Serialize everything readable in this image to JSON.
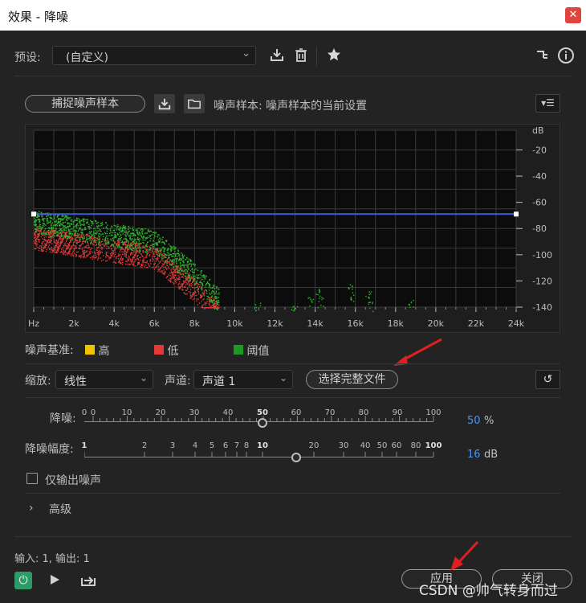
{
  "window": {
    "title": "效果 - 降噪",
    "close_glyph": "✕"
  },
  "preset": {
    "label": "预设:",
    "value": "(自定义)"
  },
  "capture": {
    "button_label": "捕捉噪声样本",
    "noise_text": "噪声样本: 噪声样本的当前设置"
  },
  "graph": {
    "db_unit": "dB",
    "y_ticks": [
      "-20",
      "-40",
      "-60",
      "-80",
      "-100",
      "-120",
      "-140"
    ],
    "x_ticks": [
      "Hz",
      "2k",
      "4k",
      "6k",
      "8k",
      "10k",
      "12k",
      "14k",
      "16k",
      "18k",
      "20k",
      "22k",
      "24k"
    ],
    "threshold_db": -69
  },
  "legend": {
    "label": "噪声基准:",
    "items": [
      {
        "name": "高",
        "color": "#f3c300"
      },
      {
        "name": "低",
        "color": "#e23a3a"
      },
      {
        "name": "阈值",
        "color": "#1e9a22"
      }
    ]
  },
  "controls": {
    "zoom_label": "缩放:",
    "zoom_value": "线性",
    "channel_label": "声道:",
    "channel_value": "声道 1",
    "select_file_label": "选择完整文件"
  },
  "noise_reduction": {
    "label": "降噪:",
    "ticks": [
      "0",
      "0",
      "10",
      "20",
      "30",
      "40",
      "50",
      "60",
      "70",
      "80",
      "90",
      "100"
    ],
    "value": "50",
    "unit": "%",
    "value_fraction": 0.5
  },
  "reduce_by": {
    "label": "降噪幅度:",
    "ticks": [
      "1",
      "2",
      "3",
      "4",
      "5",
      "6",
      "7",
      "8",
      "10",
      "20",
      "30",
      "40",
      "50",
      "60",
      "80",
      "100"
    ],
    "value": "16",
    "unit": "dB"
  },
  "output_noise_only": {
    "label": "仅输出噪声",
    "checked": false
  },
  "advanced": {
    "label": "高级"
  },
  "footer": {
    "io_text": "输入: 1, 输出: 1",
    "apply_label": "应用",
    "close_label": "关闭"
  },
  "watermark": "CSDN @帅气转身而过",
  "colors": {
    "accent_blue": "#4f93ee",
    "threshold_line": "#3a5ed8",
    "power_green": "#2e9a68",
    "annotation_red": "#e02020"
  }
}
